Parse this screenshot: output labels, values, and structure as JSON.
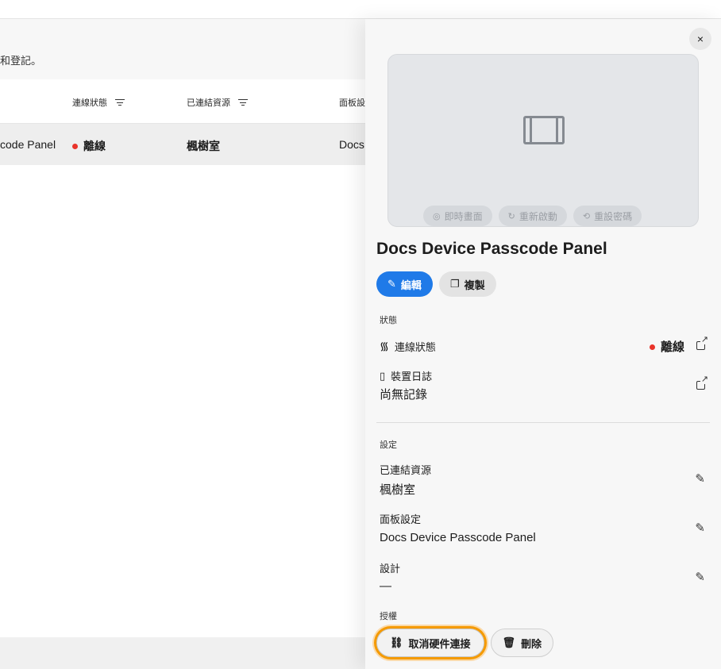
{
  "background": {
    "description_fragment": "和登記。",
    "columns": [
      {
        "label": "連線狀態"
      },
      {
        "label": "已連結資源"
      },
      {
        "label": "面板設"
      }
    ],
    "row": {
      "name_fragment": "code Panel",
      "status": "離線",
      "resource": "楓樹室",
      "panel_fragment": "Docs"
    }
  },
  "panel": {
    "close_icon": "×",
    "preview_actions": [
      {
        "icon": "camera-icon",
        "glyph": "◎",
        "label": "即時畫面"
      },
      {
        "icon": "restart-icon",
        "glyph": "↻",
        "label": "重新啟動"
      },
      {
        "icon": "reset-passcode-icon",
        "glyph": "⟲",
        "label": "重設密碼"
      }
    ],
    "title": "Docs Device Passcode Panel",
    "edit_label": "編輯",
    "copy_label": "複製",
    "status_section": {
      "label": "狀態",
      "connection_label": "連線狀態",
      "connection_value": "離線",
      "log_label": "裝置日誌",
      "log_value": "尚無記錄"
    },
    "settings_section": {
      "label": "設定",
      "resource_label": "已連結資源",
      "resource_value": "楓樹室",
      "panel_settings_label": "面板設定",
      "panel_settings_value": "Docs Device Passcode Panel",
      "design_label": "設計",
      "design_value": "—"
    },
    "license_section": {
      "label": "授權",
      "unlink_label": "取消硬件連接",
      "delete_label": "刪除"
    }
  },
  "colors": {
    "primary": "#1f7ae8",
    "offline": "#e9332a",
    "focus_ring": "#f59a00"
  }
}
